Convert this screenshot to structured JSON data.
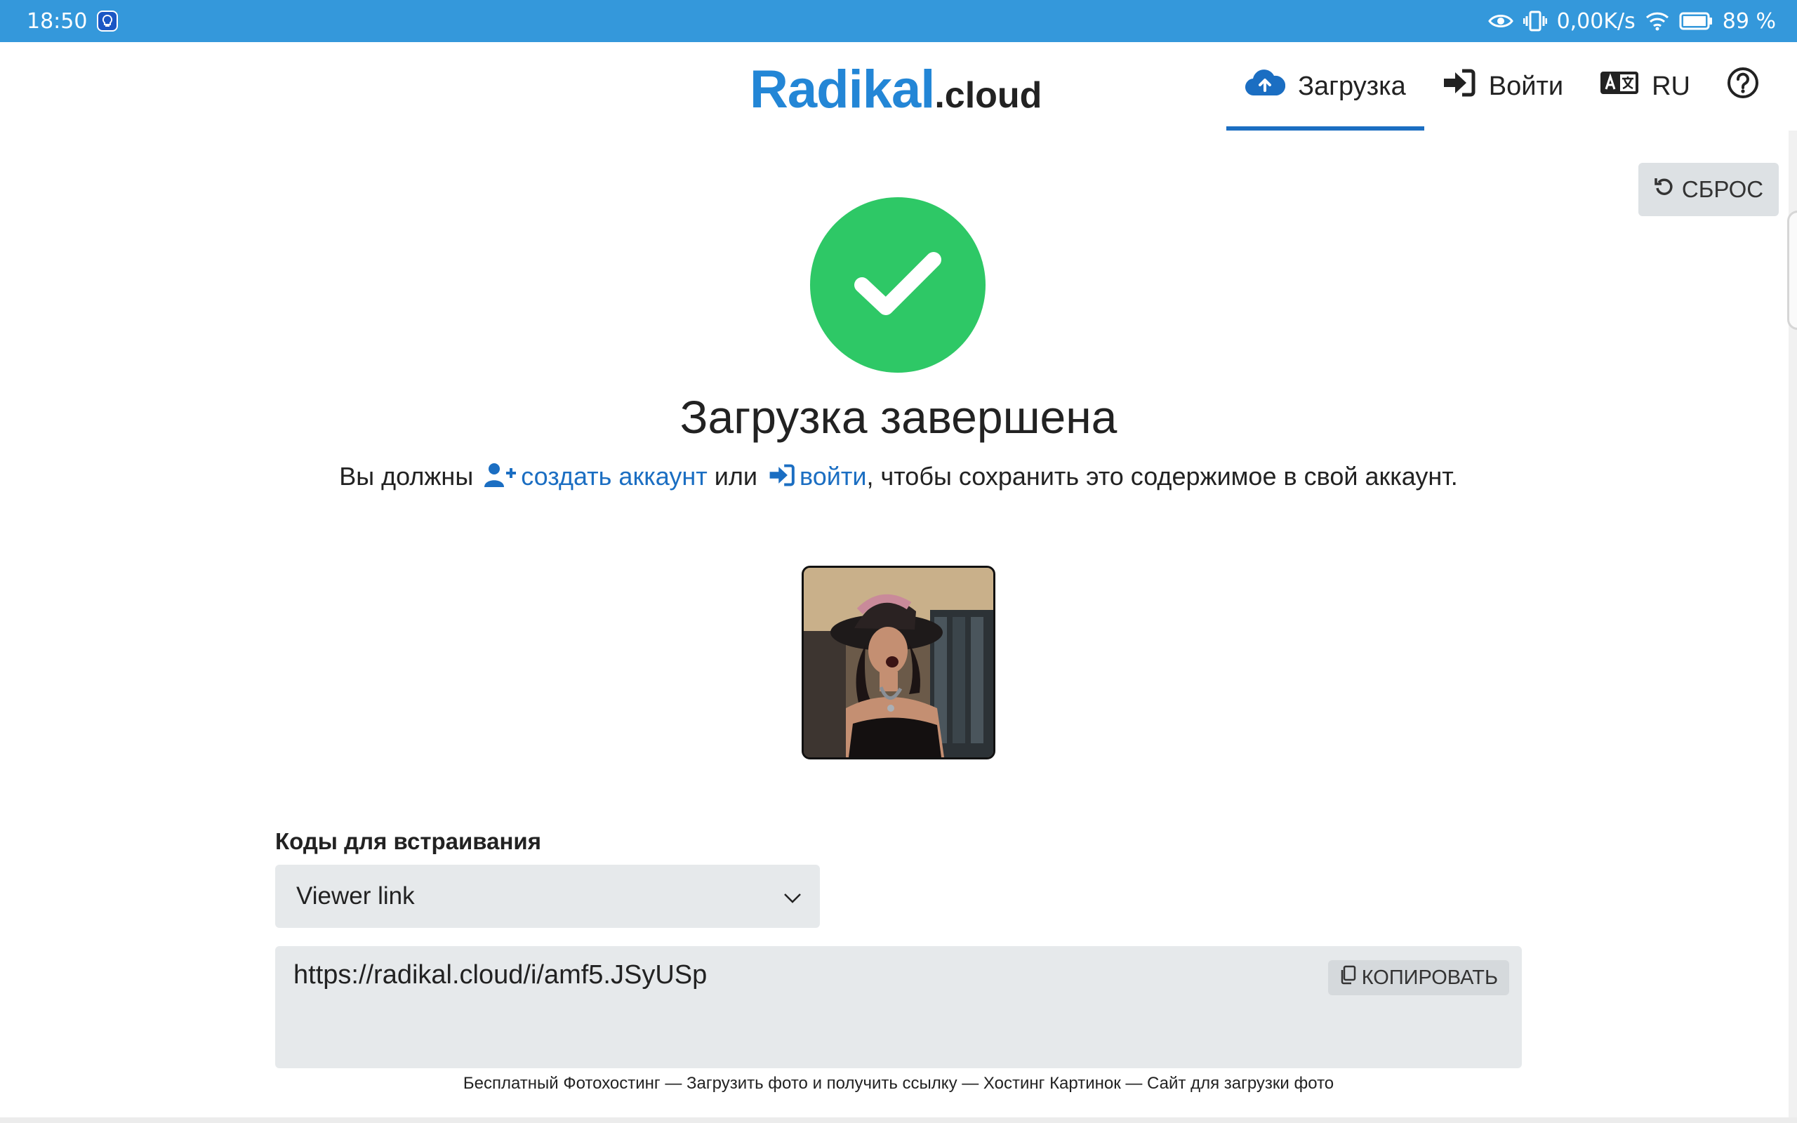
{
  "status_bar": {
    "time": "18:50",
    "net_speed": "0,00K/s",
    "battery": "89 %",
    "icons": [
      "bulb-app-icon",
      "eye-icon",
      "vibrate-icon",
      "wifi-icon",
      "battery-icon"
    ]
  },
  "header": {
    "logo_main": "Radikal",
    "logo_suffix": ".cloud",
    "nav": {
      "upload": "Загрузка",
      "login": "Войти",
      "language": "RU"
    }
  },
  "reset_label": "СБРОС",
  "main": {
    "title": "Загрузка завершена",
    "notice_prefix": "Вы должны",
    "create_account_link": "создать аккаунт",
    "or": "или",
    "login_link": "войти",
    "notice_suffix": ", чтобы сохранить это содержимое в свой аккаунт."
  },
  "embed": {
    "label": "Коды для встраивания",
    "selected": "Viewer link",
    "code": "https://radikal.cloud/i/amf5.JSyUSp",
    "copy_label": "КОПИРОВАТЬ"
  },
  "footer": "Бесплатный Фотохостинг — Загрузить фото и получить ссылку — Хостинг Картинок — Сайт для загрузки фото",
  "colors": {
    "status_bar": "#3498db",
    "brand_blue": "#2386d6",
    "link": "#1b6ec2",
    "success": "#2ec866",
    "field_bg": "#e6e9eb"
  }
}
